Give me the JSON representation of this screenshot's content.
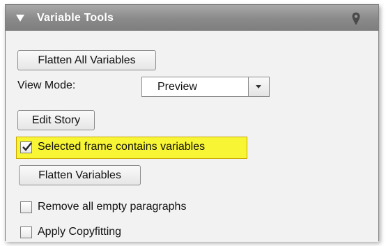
{
  "panel": {
    "title": "Variable Tools",
    "collapse_icon": "triangle-down-icon",
    "pin_icon": "map-pin-icon"
  },
  "buttons": {
    "flatten_all": "Flatten All Variables",
    "edit_story": "Edit Story",
    "flatten_variables": "Flatten Variables"
  },
  "view_mode": {
    "label": "View Mode:",
    "selected": "Preview"
  },
  "checkboxes": {
    "selected_frame": {
      "label": "Selected frame contains variables",
      "checked": true
    },
    "remove_empty": {
      "label": "Remove all empty paragraphs",
      "checked": false
    },
    "apply_copyfitting": {
      "label": "Apply Copyfitting",
      "checked": false
    }
  },
  "colors": {
    "highlight": "#f7f534",
    "header": "#8a8a8a"
  }
}
